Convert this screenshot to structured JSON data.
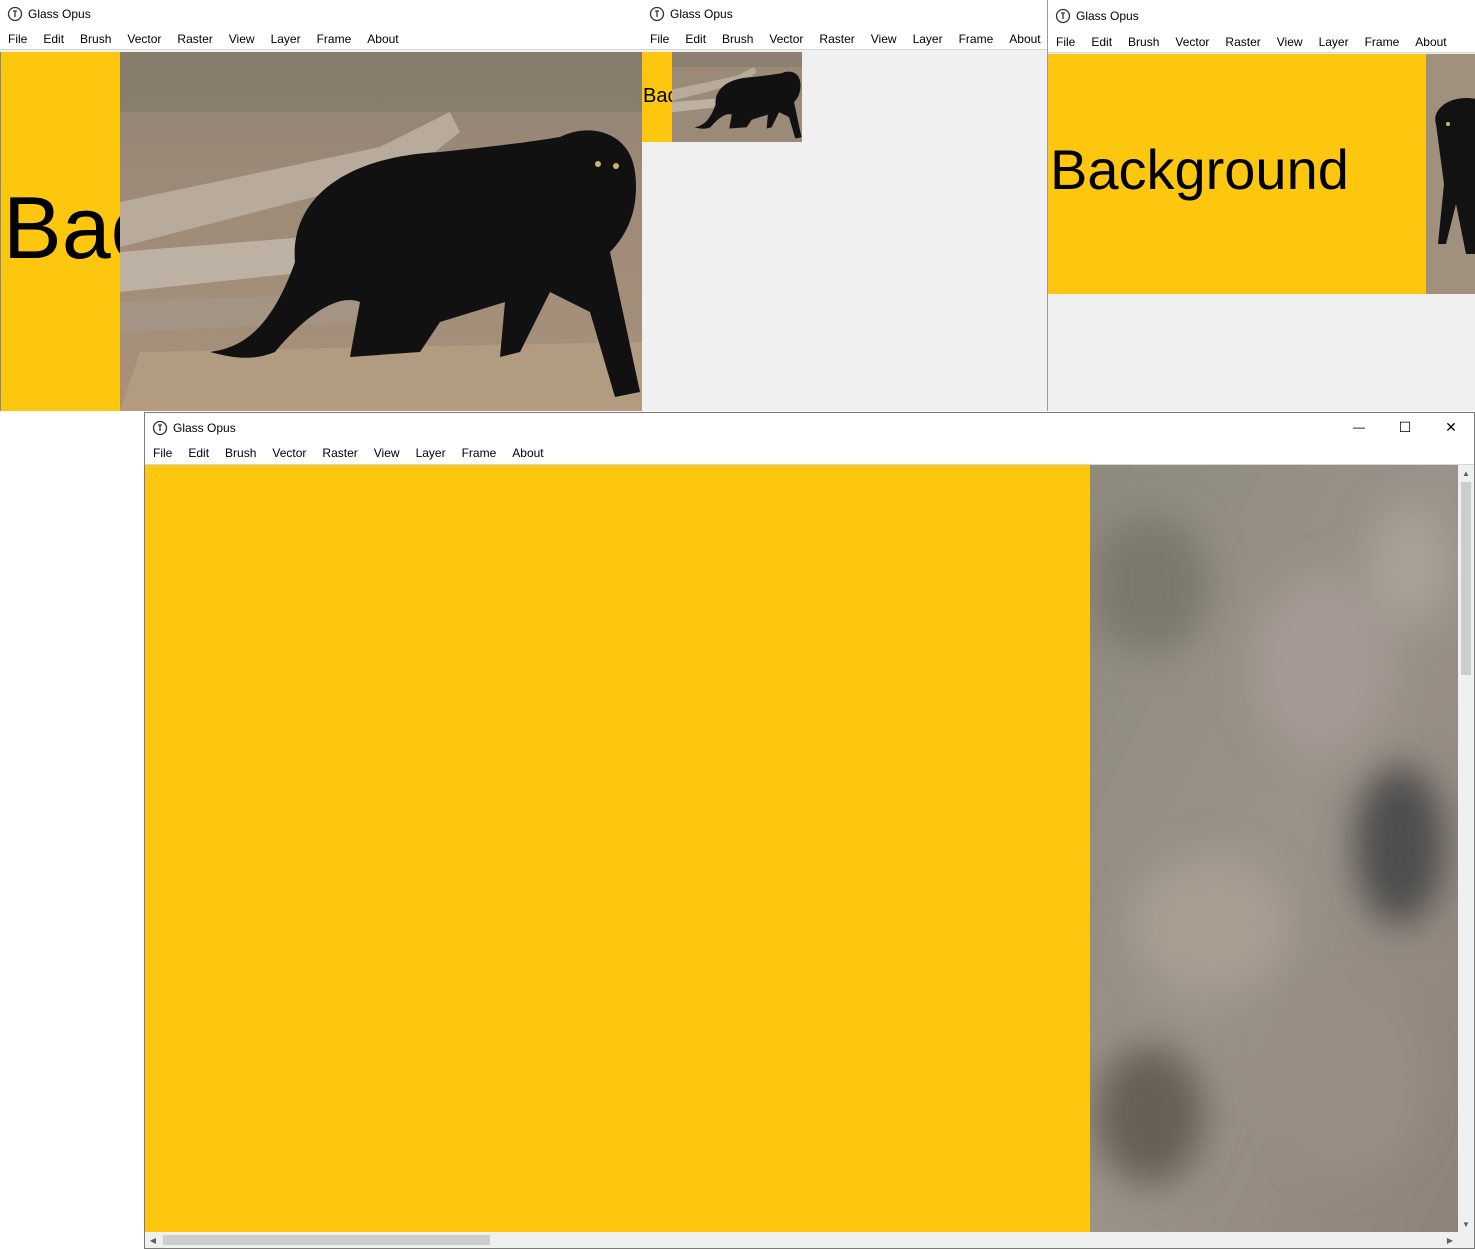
{
  "app": {
    "title": "Glass Opus"
  },
  "menu": [
    "File",
    "Edit",
    "Brush",
    "Vector",
    "Raster",
    "View",
    "Layer",
    "Frame",
    "About"
  ],
  "canvas": {
    "layer_label": "Background",
    "layer_color": "#fdc70f"
  },
  "window_controls": {
    "minimize": "—",
    "maximize": "☐",
    "close": "✕"
  },
  "scrollbar": {
    "up": "▲",
    "down": "▼",
    "left": "◀",
    "right": "▶"
  },
  "icons": [
    "app-logo-icon",
    "minimize-icon",
    "maximize-icon",
    "close-icon",
    "scroll-arrow-icon"
  ]
}
